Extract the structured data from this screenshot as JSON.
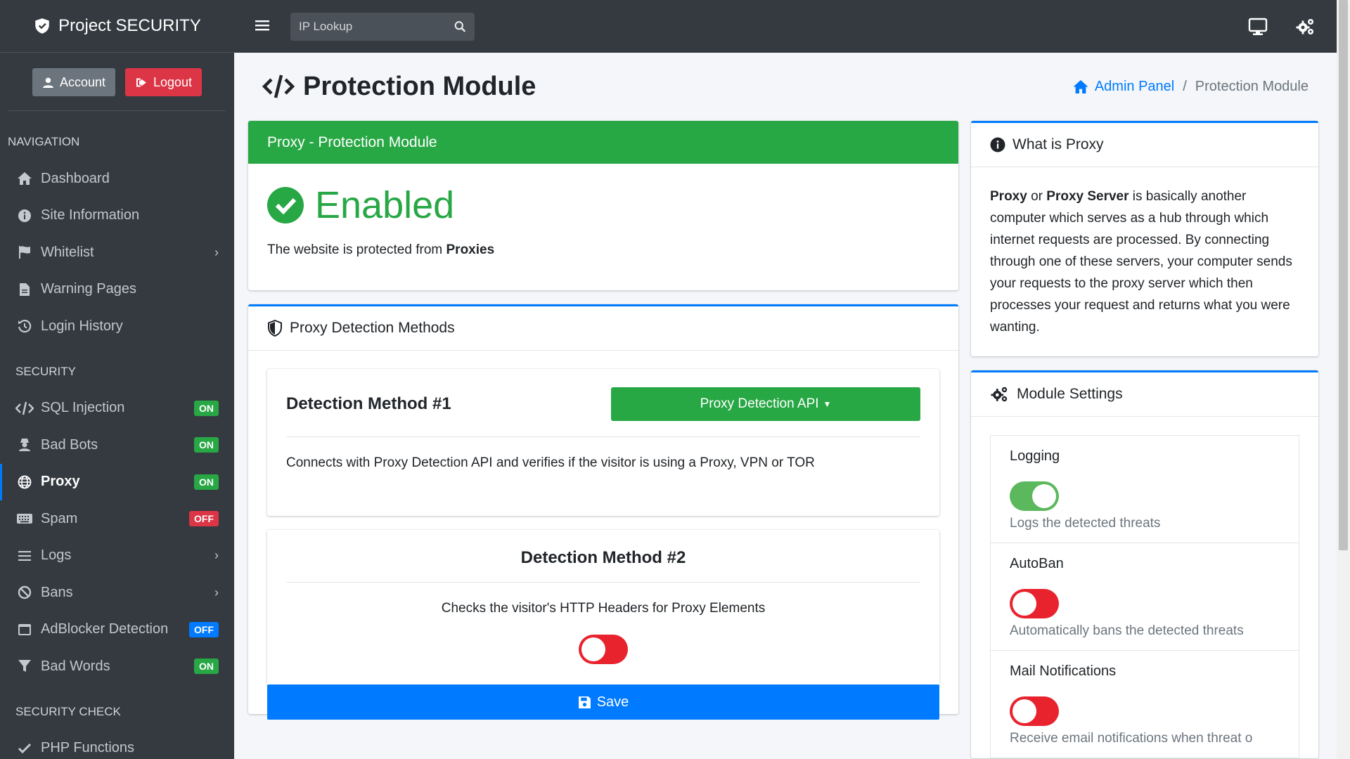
{
  "brand": {
    "name": "Project SECURITY"
  },
  "user": {
    "account_label": "Account",
    "logout_label": "Logout"
  },
  "sidebar": {
    "navigation_header": "NAVIGATION",
    "navigation_items": [
      {
        "label": "Dashboard",
        "icon": "home-icon"
      },
      {
        "label": "Site Information",
        "icon": "info-icon"
      },
      {
        "label": "Whitelist",
        "icon": "flag-icon"
      },
      {
        "label": "Warning Pages",
        "icon": "file-icon"
      },
      {
        "label": "Login History",
        "icon": "history-icon"
      }
    ],
    "security_header": "SECURITY",
    "security_items": [
      {
        "label": "SQL Injection",
        "badge": "ON"
      },
      {
        "label": "Bad Bots",
        "badge": "ON"
      },
      {
        "label": "Proxy",
        "badge": "ON"
      },
      {
        "label": "Spam",
        "badge": "OFF"
      },
      {
        "label": "Logs"
      },
      {
        "label": "Bans"
      },
      {
        "label": "AdBlocker Detection",
        "badge": "OFF"
      },
      {
        "label": "Bad Words",
        "badge": "ON"
      }
    ],
    "security_check_header": "SECURITY CHECK",
    "security_check_items": [
      {
        "label": "PHP Functions"
      }
    ]
  },
  "topbar": {
    "search_placeholder": "IP Lookup"
  },
  "page": {
    "title": "Protection Module",
    "breadcrumb": {
      "home": "Admin Panel",
      "current": "Protection Module"
    }
  },
  "status_card": {
    "header": "Proxy - Protection Module",
    "status": "Enabled",
    "text_prefix": "The website is protected from ",
    "text_bold": "Proxies"
  },
  "detection_card": {
    "header": "Proxy Detection Methods",
    "method1": {
      "title": "Detection Method #1",
      "button": "Proxy Detection API",
      "description": "Connects with Proxy Detection API and verifies if the visitor is using a Proxy, VPN or TOR"
    },
    "method2": {
      "title": "Detection Method #2",
      "description": "Checks the visitor's HTTP Headers for Proxy Elements",
      "enabled": false
    },
    "save_label": "Save"
  },
  "info_card": {
    "header": "What is Proxy",
    "bold1": "Proxy",
    "or": " or ",
    "bold2": "Proxy Server",
    "text": " is basically another computer which serves as a hub through which internet requests are processed. By connecting through one of these servers, your computer sends your requests to the proxy server which then processes your request and returns what you were wanting."
  },
  "settings_card": {
    "header": "Module Settings",
    "settings": [
      {
        "title": "Logging",
        "description": "Logs the detected threats",
        "enabled": true
      },
      {
        "title": "AutoBan",
        "description": "Automatically bans the detected threats",
        "enabled": false
      },
      {
        "title": "Mail Notifications",
        "description": "Receive email notifications when threat o",
        "enabled": false
      }
    ]
  },
  "colors": {
    "sidebar_bg": "#343a40",
    "green": "#28a745",
    "blue": "#007bff",
    "red": "#dc3545"
  }
}
